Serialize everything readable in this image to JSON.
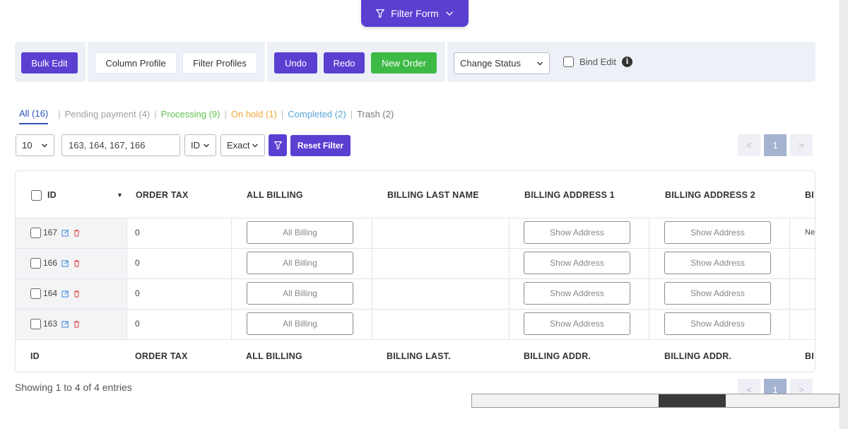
{
  "filter_form": {
    "label": "Filter Form"
  },
  "toolbar": {
    "bulk_edit": "Bulk Edit",
    "column_profile": "Column Profile",
    "filter_profiles": "Filter Profiles",
    "undo": "Undo",
    "redo": "Redo",
    "new_order": "New Order",
    "change_status": "Change Status",
    "bind_edit": "Bind Edit",
    "info_icon": "i"
  },
  "status_tabs": {
    "all": "All (16)",
    "pending": "Pending payment (4)",
    "processing": "Processing (9)",
    "on_hold": "On hold (1)",
    "completed": "Completed (2)",
    "trash": "Trash (2)",
    "divider": "|"
  },
  "filter_bar": {
    "per_page": "10",
    "search_value": "163, 164, 167, 166",
    "field": "ID",
    "match": "Exact",
    "reset": "Reset Filter"
  },
  "pagination": {
    "prev": "<",
    "page": "1",
    "next": ">"
  },
  "table": {
    "headers": [
      "ID",
      "ORDER TAX",
      "ALL BILLING",
      "BILLING LAST NAME",
      "BILLING ADDRESS 1",
      "BILLING ADDRESS 2",
      "BI"
    ],
    "sort_indicator": "▼",
    "footers": [
      "ID",
      "ORDER TAX",
      "ALL BILLING",
      "BILLING LAST.",
      "BILLING ADDR.",
      "BILLING ADDR.",
      "BI"
    ],
    "rows": [
      {
        "id": "167",
        "tax": "0",
        "billing_btn": "All Billing",
        "addr1_btn": "Show Address",
        "addr2_btn": "Show Address",
        "extra": "Ne"
      },
      {
        "id": "166",
        "tax": "0",
        "billing_btn": "All Billing",
        "addr1_btn": "Show Address",
        "addr2_btn": "Show Address",
        "extra": ""
      },
      {
        "id": "164",
        "tax": "0",
        "billing_btn": "All Billing",
        "addr1_btn": "Show Address",
        "addr2_btn": "Show Address",
        "extra": ""
      },
      {
        "id": "163",
        "tax": "0",
        "billing_btn": "All Billing",
        "addr1_btn": "Show Address",
        "addr2_btn": "Show Address",
        "extra": ""
      }
    ]
  },
  "footer": {
    "showing": "Showing 1 to 4 of 4 entries"
  },
  "colors": {
    "accent": "#5a3fd1",
    "success": "#3dba45",
    "link": "#2f54b8"
  }
}
